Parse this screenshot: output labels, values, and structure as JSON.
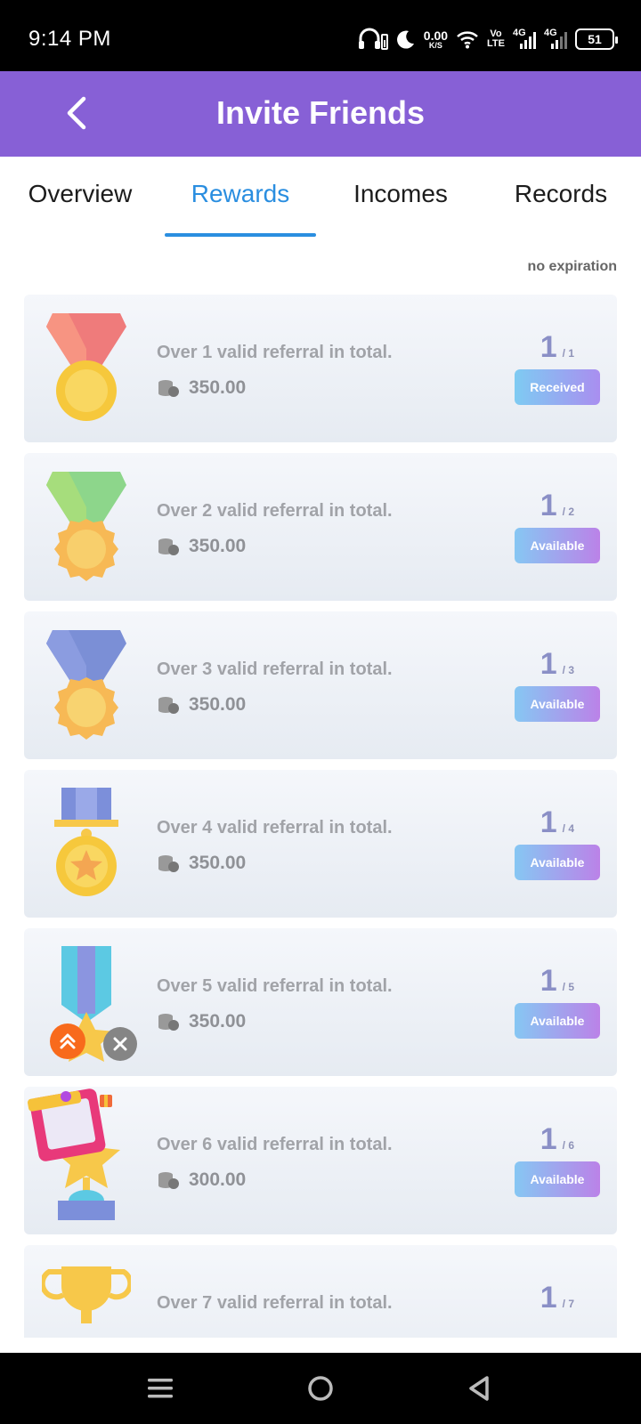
{
  "status_bar": {
    "time": "9:14 PM",
    "net_speed_value": "0.00",
    "net_speed_unit": "K/S",
    "volte_top": "Vo",
    "volte_bottom": "LTE",
    "net1": "4G",
    "net2": "4G",
    "battery": "51",
    "icons": [
      "headphones-icon",
      "moon-icon",
      "wifi-icon",
      "signal-icon",
      "battery-icon"
    ]
  },
  "header": {
    "title": "Invite Friends",
    "back_icon": "chevron-left-icon"
  },
  "tabs": [
    {
      "label": "Overview",
      "active": false
    },
    {
      "label": "Rewards",
      "active": true
    },
    {
      "label": "Incomes",
      "active": false
    },
    {
      "label": "Records",
      "active": false
    }
  ],
  "expiry_note": "no expiration",
  "rewards": [
    {
      "text": "Over 1 valid referral in total.",
      "amount": "350.00",
      "current": "1",
      "target": "/ 1",
      "button": "Received"
    },
    {
      "text": "Over 2 valid referral in total.",
      "amount": "350.00",
      "current": "1",
      "target": "/ 2",
      "button": "Available"
    },
    {
      "text": "Over 3 valid referral in total.",
      "amount": "350.00",
      "current": "1",
      "target": "/ 3",
      "button": "Available"
    },
    {
      "text": "Over 4 valid referral in total.",
      "amount": "350.00",
      "current": "1",
      "target": "/ 4",
      "button": "Available"
    },
    {
      "text": "Over 5 valid referral in total.",
      "amount": "350.00",
      "current": "1",
      "target": "/ 5",
      "button": "Available"
    },
    {
      "text": "Over 6 valid referral in total.",
      "amount": "300.00",
      "current": "1",
      "target": "/ 6",
      "button": "Available"
    },
    {
      "text": "Over 7 valid referral in total.",
      "amount": "",
      "current": "1",
      "target": "/ 7",
      "button": ""
    }
  ],
  "colors": {
    "header_bg": "#8760d6",
    "tab_active": "#2a8ee0",
    "float_up": "#f86a1c"
  },
  "nav_bar": {
    "icons": [
      "menu-icon",
      "home-circle-icon",
      "back-triangle-icon"
    ]
  }
}
